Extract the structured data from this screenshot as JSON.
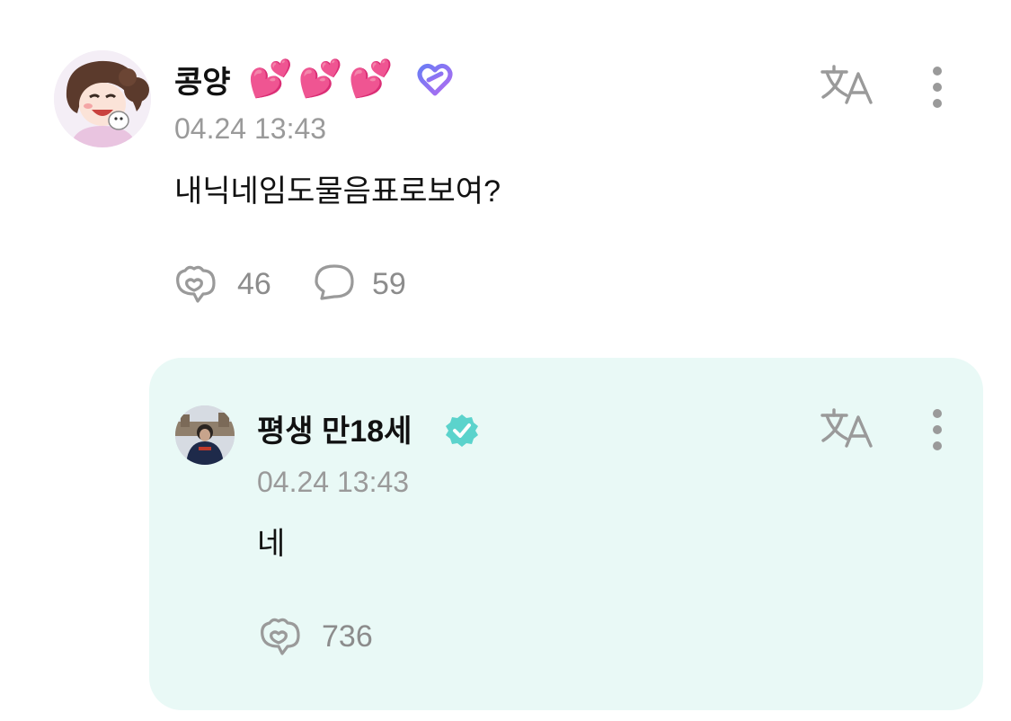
{
  "comment": {
    "username": "콩양",
    "emojis": "💕💕💕",
    "timestamp": "04.24 13:43",
    "text": "내닉네임도물음표로보여?",
    "like_count": "46",
    "reply_count": "59"
  },
  "reply": {
    "username": "평생 만18세",
    "timestamp": "04.24 13:43",
    "text": "네",
    "like_count": "736"
  },
  "colors": {
    "reply_background": "#e9f9f6",
    "verified_badge": "#5bd3cc",
    "heart_pink": "#ee3d9b",
    "muted_text": "#9a9a9a"
  },
  "icons": {
    "translate": "translate-icon",
    "more": "more-vertical-icon",
    "like": "heart-bubble-icon",
    "comment": "comment-icon",
    "verified": "verified-badge-icon",
    "membership": "membership-heart-icon"
  }
}
